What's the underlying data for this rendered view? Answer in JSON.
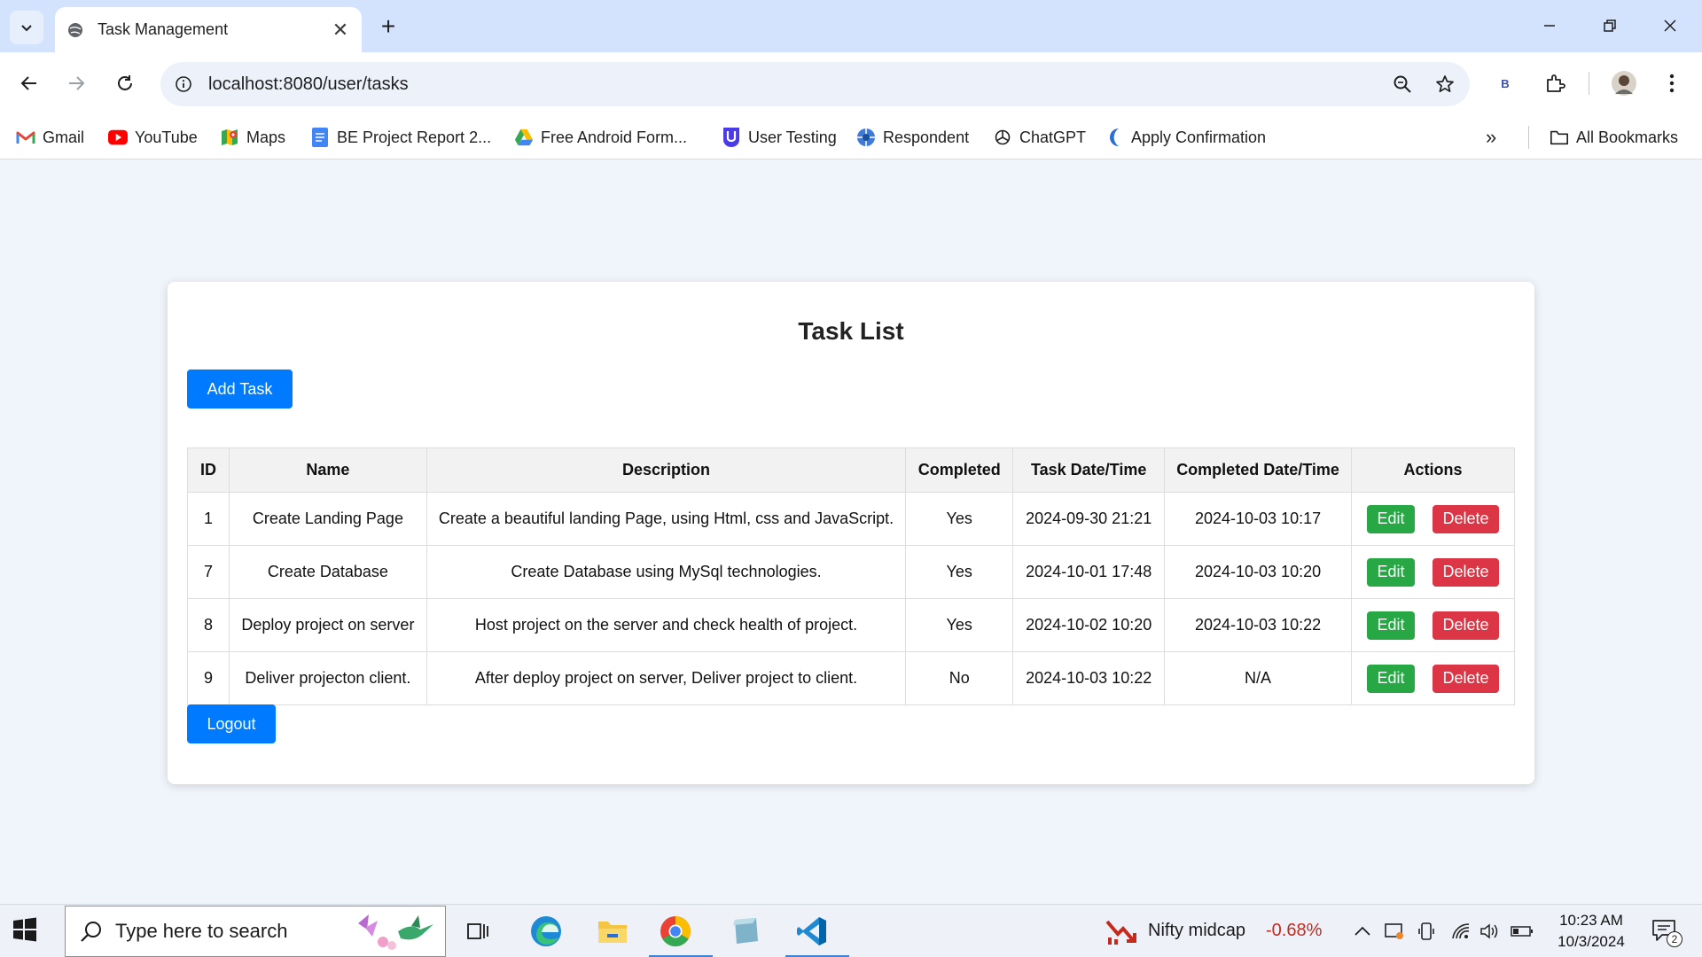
{
  "browser": {
    "tab_title": "Task Management",
    "url": "localhost:8080/user/tasks",
    "profile_badge": "B"
  },
  "bookmarks": [
    {
      "label": "Gmail",
      "icon": "gmail-icon"
    },
    {
      "label": "YouTube",
      "icon": "youtube-icon"
    },
    {
      "label": "Maps",
      "icon": "maps-icon"
    },
    {
      "label": "BE Project Report 2...",
      "icon": "docs-icon"
    },
    {
      "label": "Free Android Form...",
      "icon": "drive-icon"
    },
    {
      "label": "User Testing",
      "icon": "usertesting-icon"
    },
    {
      "label": "Respondent",
      "icon": "respondent-icon"
    },
    {
      "label": "ChatGPT",
      "icon": "chatgpt-icon"
    },
    {
      "label": "Apply Confirmation",
      "icon": "apply-icon"
    }
  ],
  "all_bookmarks_label": "All Bookmarks",
  "page": {
    "title": "Task List",
    "add_task_label": "Add Task",
    "logout_label": "Logout",
    "columns": [
      "ID",
      "Name",
      "Description",
      "Completed",
      "Task Date/Time",
      "Completed Date/Time",
      "Actions"
    ],
    "edit_label": "Edit",
    "delete_label": "Delete",
    "rows": [
      {
        "id": "1",
        "name": "Create Landing Page",
        "description": "Create a beautiful landing Page, using Html, css and JavaScript.",
        "completed": "Yes",
        "task_datetime": "2024-09-30 21:21",
        "completed_datetime": "2024-10-03 10:17"
      },
      {
        "id": "7",
        "name": "Create Database",
        "description": "Create Database using MySql technologies.",
        "completed": "Yes",
        "task_datetime": "2024-10-01 17:48",
        "completed_datetime": "2024-10-03 10:20"
      },
      {
        "id": "8",
        "name": "Deploy project on server",
        "description": "Host project on the server and check health of project.",
        "completed": "Yes",
        "task_datetime": "2024-10-02 10:20",
        "completed_datetime": "2024-10-03 10:22"
      },
      {
        "id": "9",
        "name": "Deliver projecton client.",
        "description": "After deploy project on server, Deliver project to client.",
        "completed": "No",
        "task_datetime": "2024-10-03 10:22",
        "completed_datetime": "N/A"
      }
    ]
  },
  "taskbar": {
    "search_placeholder": "Type here to search",
    "stock_name": "Nifty midcap",
    "stock_change": "-0.68%",
    "time": "10:23 AM",
    "date": "10/3/2024",
    "notification_count": "2"
  },
  "colors": {
    "primary": "#007bff",
    "edit": "#28a745",
    "delete": "#dc3545",
    "stock_negative": "#c42b1c"
  }
}
